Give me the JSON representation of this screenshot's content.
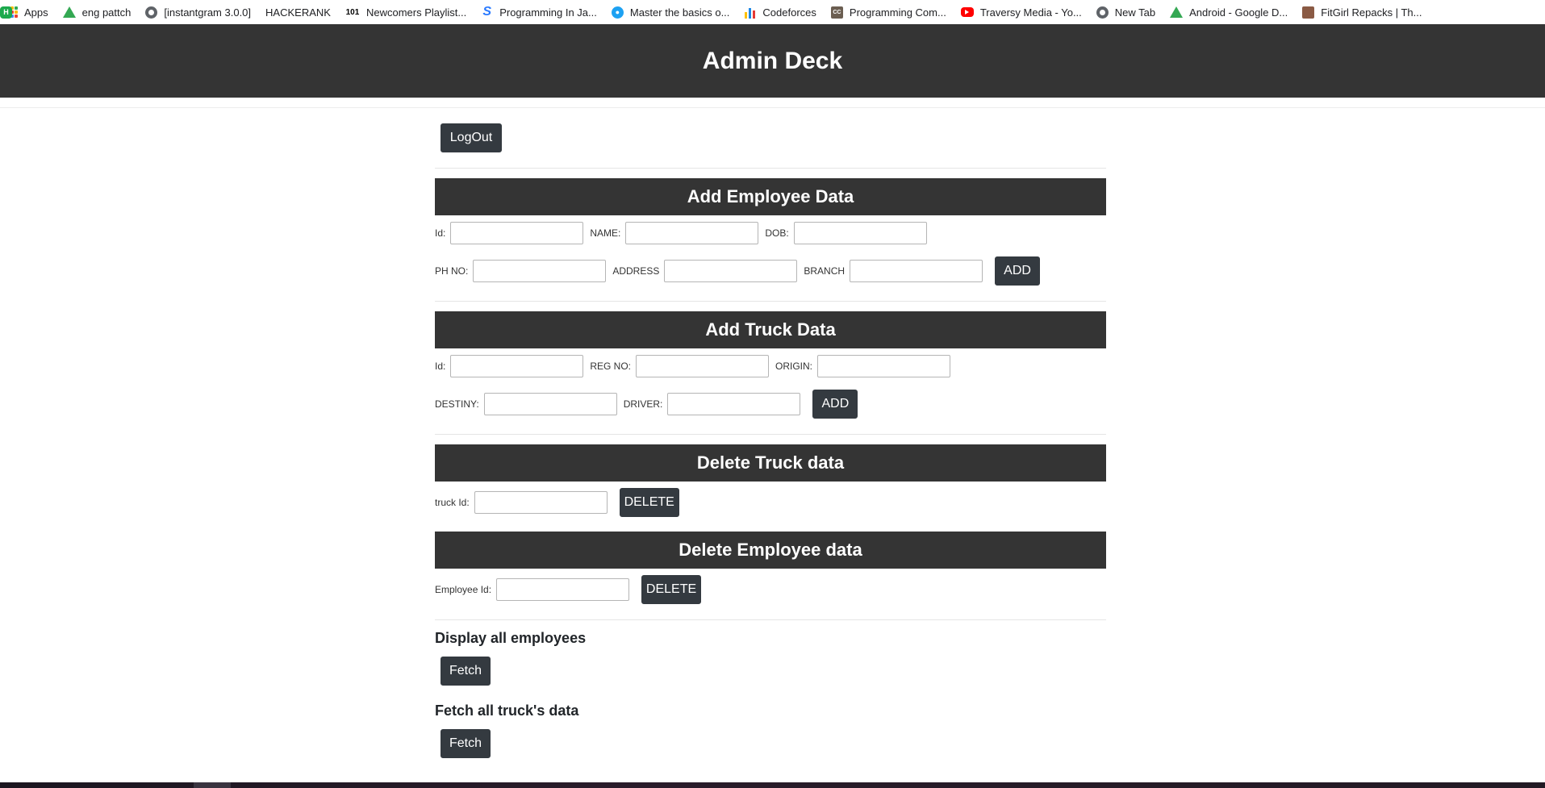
{
  "bookmarks": [
    {
      "label": "Apps",
      "icon": "apps-grid-icon"
    },
    {
      "label": "eng pattch",
      "icon": "google-drive-icon"
    },
    {
      "label": "[instantgram 3.0.0]",
      "icon": "globe-icon"
    },
    {
      "label": "HACKERANK",
      "icon": "hackerrank-icon"
    },
    {
      "label": "Newcomers Playlist...",
      "icon": "101-icon"
    },
    {
      "label": "Programming In Ja...",
      "icon": "s-logo-icon"
    },
    {
      "label": "Master the basics o...",
      "icon": "bird-logo-icon"
    },
    {
      "label": "Codeforces",
      "icon": "codeforces-icon"
    },
    {
      "label": "Programming Com...",
      "icon": "cc-logo-icon"
    },
    {
      "label": "Traversy Media - Yo...",
      "icon": "youtube-icon"
    },
    {
      "label": "New Tab",
      "icon": "globe-icon"
    },
    {
      "label": "Android - Google D...",
      "icon": "google-drive-icon"
    },
    {
      "label": "FitGirl Repacks | Th...",
      "icon": "fitgirl-icon"
    }
  ],
  "header": {
    "title": "Admin Deck"
  },
  "logout_label": "LogOut",
  "add_employee": {
    "title": "Add Employee Data",
    "fields": {
      "id": "Id:",
      "name": "NAME:",
      "dob": "DOB:",
      "phone": "PH NO:",
      "address": "ADDRESS",
      "branch": "BRANCH"
    },
    "add_label": "ADD"
  },
  "add_truck": {
    "title": "Add Truck Data",
    "fields": {
      "id": "Id:",
      "reg": "REG NO:",
      "origin": "ORIGIN:",
      "destiny": "DESTINY:",
      "driver": "DRIVER:"
    },
    "add_label": "ADD"
  },
  "delete_truck": {
    "title": "Delete Truck data",
    "field": "truck Id:",
    "delete_label": "DELETE"
  },
  "delete_employee": {
    "title": "Delete Employee data",
    "field": "Employee Id:",
    "delete_label": "DELETE"
  },
  "display_employees": {
    "title": "Display all employees",
    "fetch_label": "Fetch"
  },
  "fetch_trucks": {
    "title": "Fetch all truck's data",
    "fetch_label": "Fetch"
  },
  "colors": {
    "header_bg": "#343434",
    "button_bg": "#343a40",
    "text": "#ffffff"
  }
}
